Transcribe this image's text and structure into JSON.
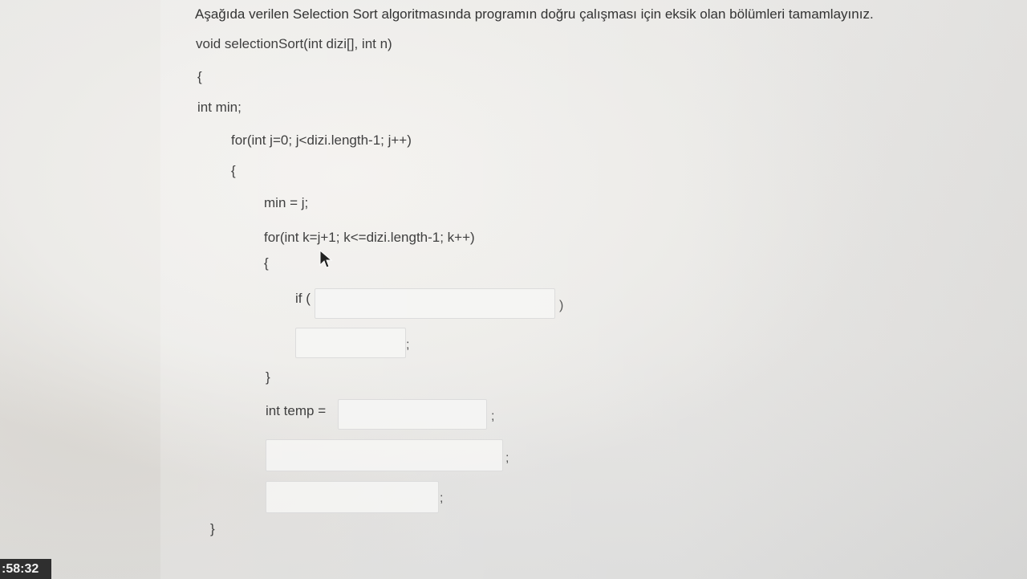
{
  "question": "Aşağıda verilen Selection Sort algoritmasında programın doğru çalışması için eksik olan bölümleri tamamlayınız.",
  "code": {
    "signature": "void selectionSort(int dizi[], int n)",
    "open_brace_1": "{",
    "decl_min": "int min;",
    "outer_for": "for(int j=0; j<dizi.length-1; j++)",
    "open_brace_2": "{",
    "assign_min": "min = j;",
    "inner_for": "for(int k=j+1; k<=dizi.length-1; k++)",
    "open_brace_3": "{",
    "if_prefix": "if (",
    "if_suffix": ")",
    "semicolon_1": ";",
    "close_brace_3": "}",
    "temp_prefix": "int temp =",
    "semicolon_2": ";",
    "semicolon_3": ";",
    "semicolon_4": ";",
    "close_brace_1": "}"
  },
  "answers": {
    "if_condition": "",
    "min_assignment": "",
    "temp_value": "",
    "swap_line_1": "",
    "swap_line_2": ""
  },
  "timer": ":58:32",
  "icons": {
    "cursor": "mouse-pointer-icon"
  }
}
